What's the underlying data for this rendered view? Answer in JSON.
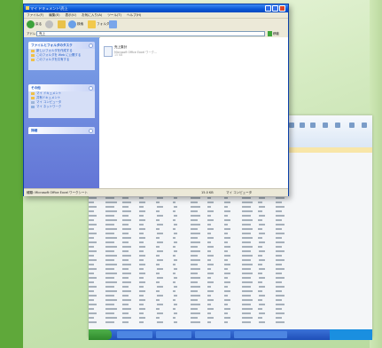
{
  "window": {
    "title": "マイ ドキュメント\\売上",
    "menu": [
      "ファイル(F)",
      "編集(E)",
      "表示(V)",
      "お気に入り(A)",
      "ツール(T)",
      "ヘルプ(H)"
    ],
    "toolbar": {
      "back": "戻る",
      "search": "検索",
      "folders": "フォルダ"
    },
    "address_label": "アドレス(D)",
    "address_value": "売上",
    "go_label": "移動"
  },
  "sidebar": {
    "panels": [
      {
        "title": "ファイルとフォルダのタスク",
        "items": [
          "新しいフォルダを作成する",
          "このフォルダを Web に公開する",
          "このフォルダを共有する"
        ]
      },
      {
        "title": "その他",
        "items": [
          "マイ ドキュメント",
          "共有ドキュメント",
          "マイ コンピュータ",
          "マイ ネットワーク"
        ]
      },
      {
        "title": "詳細",
        "items": []
      }
    ]
  },
  "content": {
    "file": {
      "name": "売上集計",
      "type": "Microsoft Office Excel ワーク...",
      "size": "15 KB"
    }
  },
  "statusbar": {
    "left": "種類: Microsoft Office Excel ワークシート",
    "size": "15.0 KB",
    "location": "マイ コンピュータ"
  },
  "colors": {
    "titlebar": "#0a57d6",
    "sidebar": "#6f8ee0",
    "taskbar": "#2459c8",
    "frame_green": "#7cc04a"
  }
}
